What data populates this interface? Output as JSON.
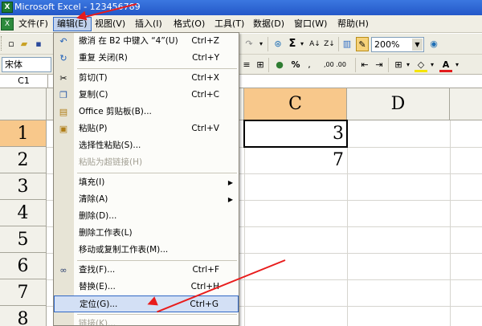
{
  "window": {
    "title": "Microsoft Excel - 123456789"
  },
  "menubar": {
    "items": [
      "文件(F)",
      "编辑(E)",
      "视图(V)",
      "插入(I)",
      "格式(O)",
      "工具(T)",
      "数据(D)",
      "窗口(W)",
      "帮助(H)"
    ]
  },
  "toolbar": {
    "zoom": "200%",
    "font_name": "宋体",
    "sigma": "Σ",
    "percent": "%",
    "decimal": ",00 .00"
  },
  "formula_bar": {
    "name_box": "C1"
  },
  "sheet": {
    "columns": [
      "C",
      "D"
    ],
    "rows": [
      "1",
      "2",
      "3",
      "4",
      "5",
      "6",
      "7",
      "8"
    ],
    "cells": {
      "C1": "3",
      "C2": "7"
    }
  },
  "edit_menu": {
    "items": [
      {
        "label": "撤消 在 B2 中键入 “4”(U)",
        "shortcut": "Ctrl+Z",
        "icon": "undo-icon"
      },
      {
        "label": "重复 关闭(R)",
        "shortcut": "Ctrl+Y",
        "icon": "redo-icon"
      },
      {
        "label": "剪切(T)",
        "shortcut": "Ctrl+X",
        "icon": "scissors-icon"
      },
      {
        "label": "复制(C)",
        "shortcut": "Ctrl+C",
        "icon": "copy-icon"
      },
      {
        "label": "Office 剪贴板(B)...",
        "shortcut": "",
        "icon": "clipboard-icon"
      },
      {
        "label": "粘贴(P)",
        "shortcut": "Ctrl+V",
        "icon": "paste-icon"
      },
      {
        "label": "选择性粘贴(S)...",
        "shortcut": "",
        "icon": ""
      },
      {
        "label": "粘贴为超链接(H)",
        "shortcut": "",
        "icon": ""
      },
      {
        "label": "填充(I)",
        "shortcut": "",
        "icon": ""
      },
      {
        "label": "清除(A)",
        "shortcut": "",
        "icon": ""
      },
      {
        "label": "删除(D)...",
        "shortcut": "",
        "icon": ""
      },
      {
        "label": "删除工作表(L)",
        "shortcut": "",
        "icon": ""
      },
      {
        "label": "移动或复制工作表(M)...",
        "shortcut": "",
        "icon": ""
      },
      {
        "label": "查找(F)...",
        "shortcut": "Ctrl+F",
        "icon": "binoculars-icon"
      },
      {
        "label": "替换(E)...",
        "shortcut": "Ctrl+H",
        "icon": ""
      },
      {
        "label": "定位(G)...",
        "shortcut": "Ctrl+G",
        "icon": ""
      },
      {
        "label": "链接(K)...",
        "shortcut": "",
        "icon": ""
      }
    ]
  },
  "colors": {
    "title_bar": "#2458c8",
    "selected_header": "#f8c88b",
    "menu_highlight": "#d3e0f5",
    "annotation": "#e81c1c"
  }
}
